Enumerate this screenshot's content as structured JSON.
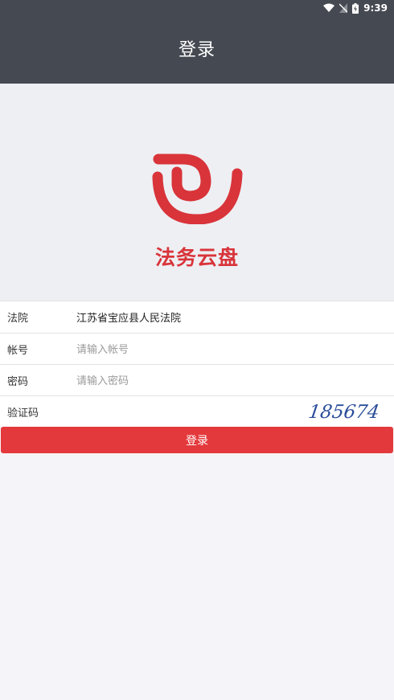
{
  "status_bar": {
    "time": "9:39"
  },
  "header": {
    "title": "登录"
  },
  "brand": {
    "name": "法务云盘",
    "color": "#d8343a"
  },
  "form": {
    "court": {
      "label": "法院",
      "value": "江苏省宝应县人民法院"
    },
    "account": {
      "label": "帐号",
      "placeholder": "请输入帐号"
    },
    "password": {
      "label": "密码",
      "placeholder": "请输入密码"
    },
    "captcha": {
      "label": "验证码",
      "code": "185674"
    }
  },
  "login_button": {
    "label": "登录",
    "color": "#e4393c"
  }
}
